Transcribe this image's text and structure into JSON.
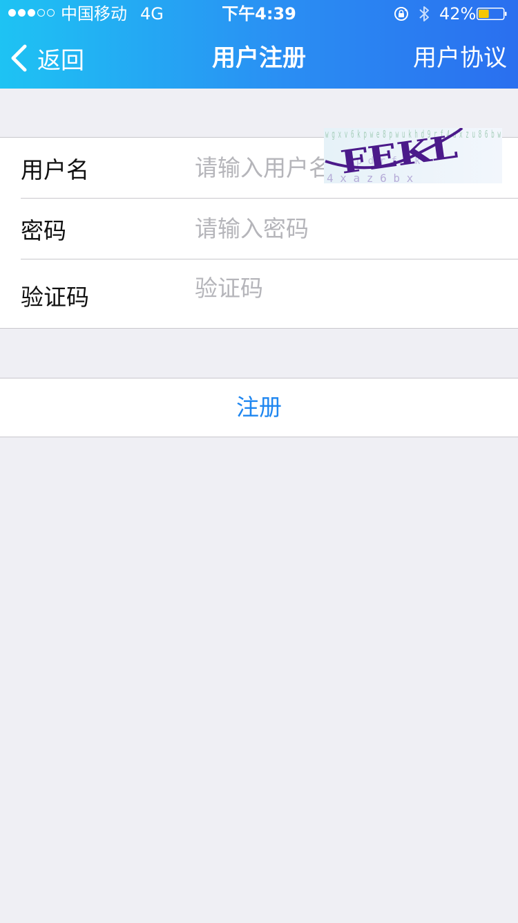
{
  "status_bar": {
    "carrier": "中国移动",
    "network": "4G",
    "time": "下午4:39",
    "battery_percent": "42%",
    "battery_level": 0.42,
    "signal_strength": 3,
    "signal_max": 5
  },
  "nav": {
    "back_label": "返回",
    "title": "用户注册",
    "right_label": "用户协议"
  },
  "form": {
    "username_label": "用户名",
    "username_placeholder": "请输入用户名",
    "password_label": "密码",
    "password_placeholder": "请输入密码",
    "captcha_label": "验证码",
    "captcha_placeholder": "验证码"
  },
  "captcha_image": {
    "text": "FEKL",
    "noise": "w g x v 6 k p w e 8 p w u k h d 9 r f 4 a x z u 8 6 b w"
  },
  "actions": {
    "register_label": "注册"
  },
  "colors": {
    "header_gradient_start": "#1EC3F3",
    "header_gradient_end": "#2A6FEF",
    "accent": "#1E86F0",
    "background": "#EFEFF4",
    "battery_fill": "#F6C700",
    "captcha_ink": "#4B1A8A"
  }
}
